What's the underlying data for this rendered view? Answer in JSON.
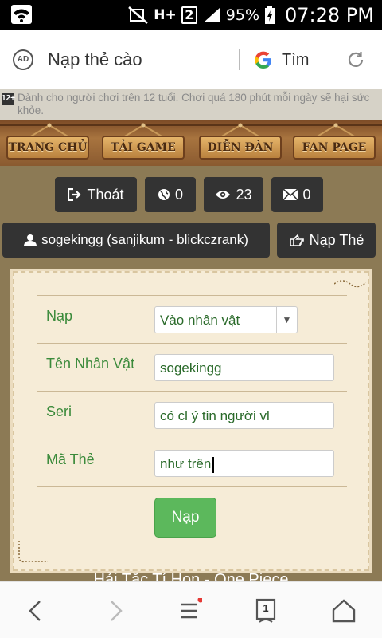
{
  "status_bar": {
    "signal_label": "H+",
    "sim_slot": "2",
    "battery": "95%",
    "time": "07:28 PM"
  },
  "browser": {
    "ad_icon": "AD",
    "title": "Nạp thẻ cào",
    "search_label": "Tìm"
  },
  "notice": {
    "badge": "12+",
    "text": "Dành cho người chơi trên 12 tuổi. Chơi quá 180 phút mỗi ngày sẽ hại sức khỏe."
  },
  "nav": {
    "items": [
      "TRANG CHỦ",
      "TẢI GAME",
      "DIỄN ĐÀN",
      "FAN PAGE"
    ]
  },
  "toolbar": {
    "logout_label": "Thoát",
    "globe_count": "0",
    "views_count": "23",
    "mail_count": "0",
    "user_label": "sogekingg (sanjikum - blickczrank)",
    "recharge_label": "Nạp Thẻ"
  },
  "form": {
    "rows": [
      {
        "label": "Nạp",
        "value": "Vào nhân vật"
      },
      {
        "label": "Tên Nhân Vật",
        "value": "sogekingg"
      },
      {
        "label": "Seri",
        "value": "có cl ý tin người vl"
      },
      {
        "label": "Mã Thẻ",
        "value": "như trên"
      }
    ],
    "submit_label": "Nạp"
  },
  "footer": {
    "text": "Hải Tặc Tí Hon - One Piece"
  },
  "bottom_nav": {
    "tabs_count": "1"
  },
  "colors": {
    "page_bg": "#8c7a55",
    "panel_bg": "#f6ecd7",
    "label_green": "#3a8a3a",
    "submit_green": "#5cb85c",
    "dark_button": "#333333"
  }
}
